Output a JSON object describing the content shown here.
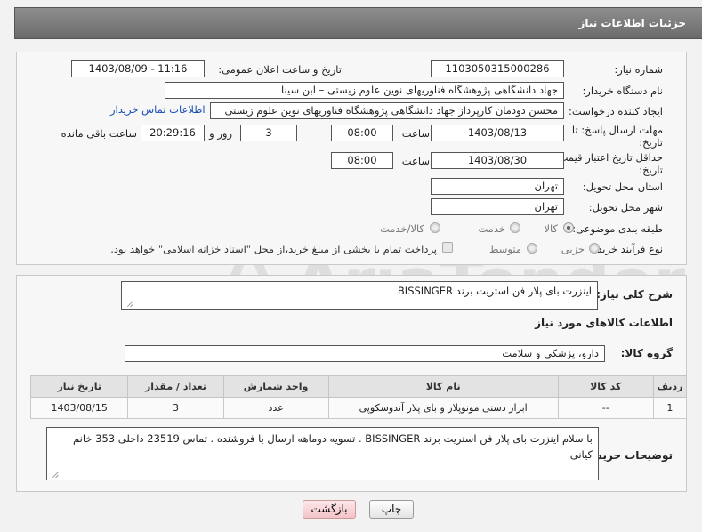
{
  "header": {
    "title": "جزئیات اطلاعات نیاز"
  },
  "fields": {
    "need_number_label": "شماره نیاز:",
    "need_number": "1103050315000286",
    "announce_label": "تاریخ و ساعت اعلان عمومی:",
    "announce_value": "1403/08/09 - 11:16",
    "buyer_label": "نام دستگاه خریدار:",
    "buyer_value": "جهاد دانشگاهی پژوهشگاه فناوریهای نوین علوم زیستی – ابن سینا",
    "creator_label": "ایجاد کننده درخواست:",
    "creator_value": "محسن دودمان کارپرداز جهاد دانشگاهی پژوهشگاه فناوریهای نوین علوم زیستی",
    "contact_link": "اطلاعات تماس خریدار",
    "deadline_label_1": "مهلت ارسال پاسخ: تا",
    "deadline_label_2": "تاریخ:",
    "deadline_date": "1403/08/13",
    "time_label": "ساعت",
    "deadline_time": "08:00",
    "days_value": "3",
    "days_label": "روز و",
    "remaining_time": "20:29:16",
    "remaining_label": "ساعت باقی مانده",
    "validity_label_1": "حداقل تاریخ اعتبار قیمت: تا",
    "validity_label_2": "تاریخ:",
    "validity_date": "1403/08/30",
    "validity_time": "08:00",
    "province_label": "استان محل تحویل:",
    "province_value": "تهران",
    "city_label": "شهر محل تحویل:",
    "city_value": "تهران",
    "category_label": "طبقه بندی موضوعی:",
    "category_options": [
      "کالا",
      "خدمت",
      "کالا/خدمت"
    ],
    "process_label": "نوع فرآیند خرید :",
    "process_options": [
      "جزیی",
      "متوسط"
    ],
    "payment_note": "پرداخت تمام یا بخشی از مبلغ خرید،از محل \"اسناد خزانه اسلامی\" خواهد بود."
  },
  "details": {
    "description_label": "شرح کلی نیاز:",
    "description_value": "اینزرت بای پلار فن استریت برند BISSINGER",
    "goods_info_title": "اطلاعات کالاهای مورد نیاز",
    "goods_group_label": "گروه کالا:",
    "goods_group_value": "دارو، پزشکی و سلامت"
  },
  "table": {
    "headers": [
      "ردیف",
      "کد کالا",
      "نام کالا",
      "واحد شمارش",
      "تعداد / مقدار",
      "تاریخ نیاز"
    ],
    "rows": [
      [
        "1",
        "--",
        "ابزار دستی مونوپلار و بای پلار آندوسکوپی",
        "عدد",
        "3",
        "1403/08/15"
      ]
    ]
  },
  "buyer_notes": {
    "label": "توضیحات خریدار:",
    "text": "با سلام اینزرت بای پلار فن استریت برند BISSINGER . تسویه دوماهه ارسال با فروشنده . تماس 23519 داخلی 353 خانم کیانی"
  },
  "buttons": {
    "print": "چاپ",
    "back": "بازگشت"
  },
  "watermark": {
    "text": "AriaTender.net"
  }
}
